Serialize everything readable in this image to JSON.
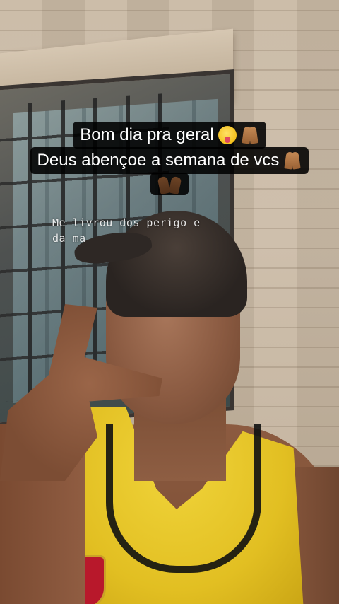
{
  "caption": {
    "line1": {
      "text": "Bom dia pra geral",
      "emojis": [
        "squinting-tongue-face-emoji",
        "praying-hands-emoji"
      ]
    },
    "line2": {
      "text": "Deus abençoe a semana de vcs",
      "emojis": [
        "praying-hands-emoji"
      ]
    },
    "line3": {
      "text": "",
      "emojis": [
        "raising-hands-emoji"
      ]
    }
  },
  "lyric_overlay": {
    "line1": "Me livrou dos perigo e",
    "line2": "da ma"
  },
  "colors": {
    "caption_background": "#000000",
    "caption_text": "#ffffff",
    "shirt": "#e2bf22"
  }
}
